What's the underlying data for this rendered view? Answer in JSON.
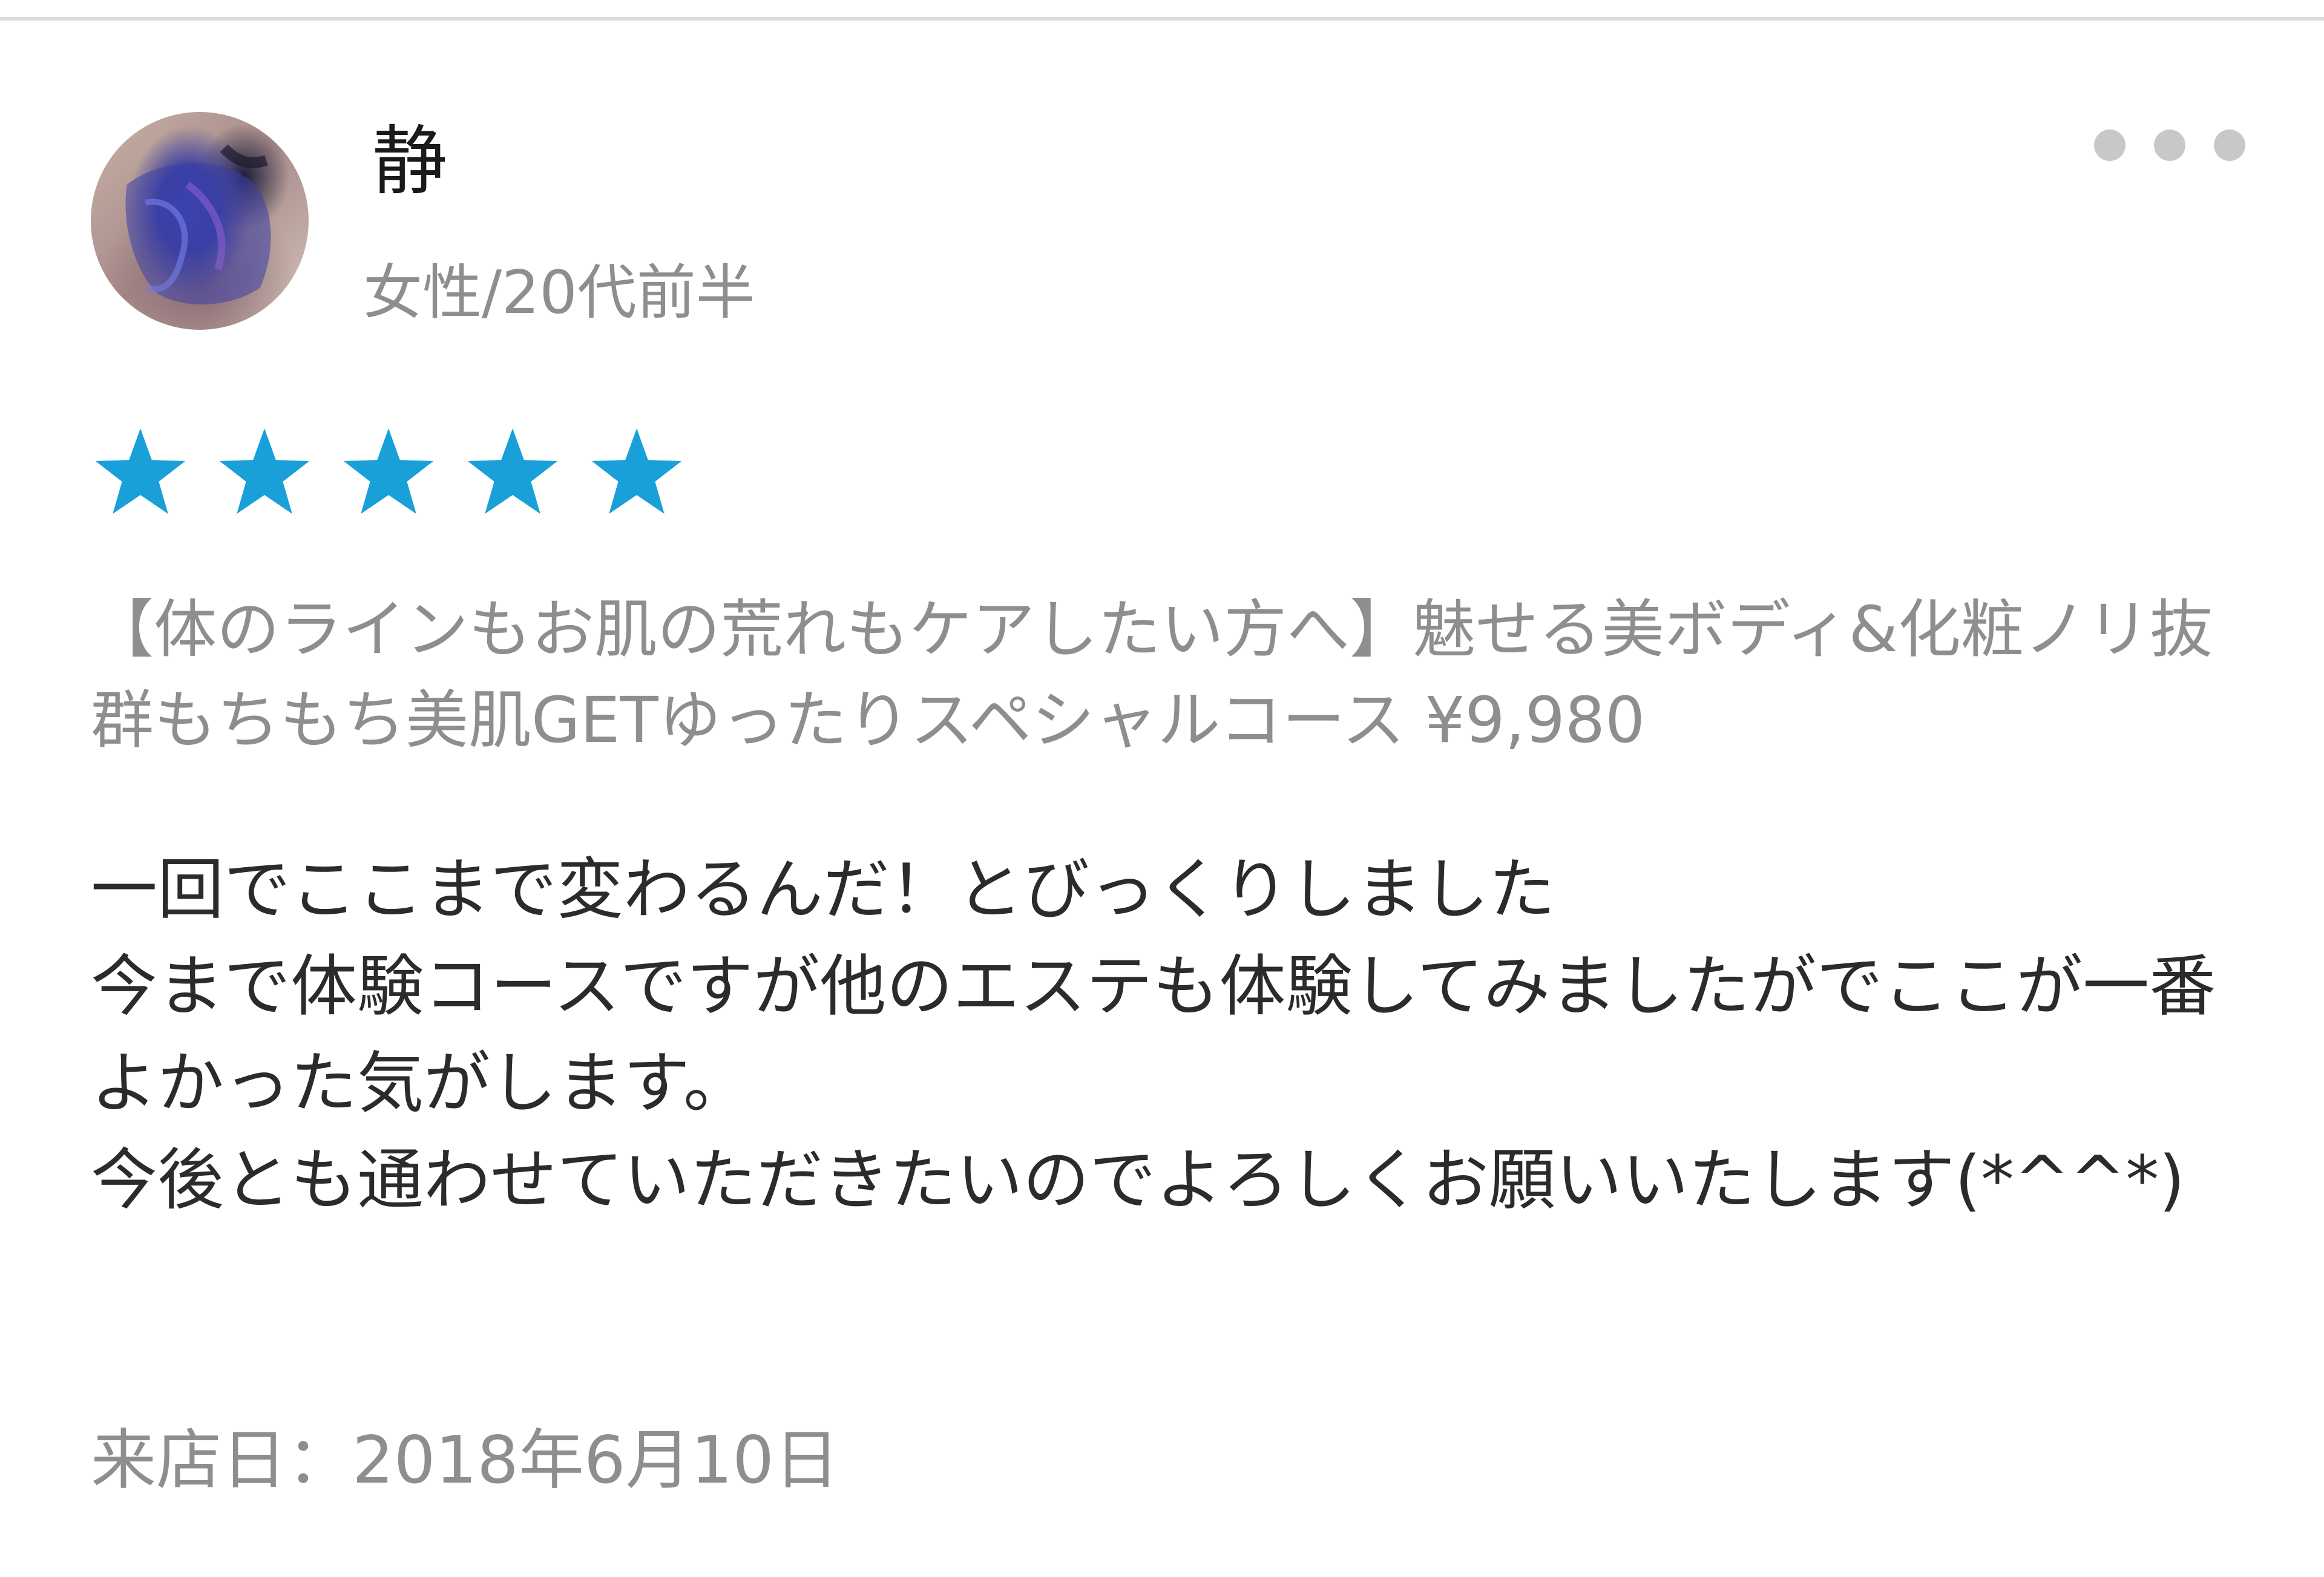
{
  "review": {
    "user_name": "静",
    "user_meta": "女性/20代前半",
    "rating": 5,
    "rating_color": "#1aa0d8",
    "course_title": "【体のラインもお肌の荒れもケアしたい方へ】魅せる美ボディ&化粧ノリ抜群もちもち美肌GETゆったりスペシャルコース ¥9,980",
    "body": "一回でここまで変わるんだ！とびっくりしました\n今まで体験コースですが他のエステも体験してみましたがでここが一番よかった気がします。\n今後とも通わせていただきたいのでよろしくお願いいたします(*^^*)",
    "visit_date": "来店日：2018年6月10日"
  },
  "icons": {
    "more": "more-horizontal-icon",
    "star": "star-icon"
  }
}
